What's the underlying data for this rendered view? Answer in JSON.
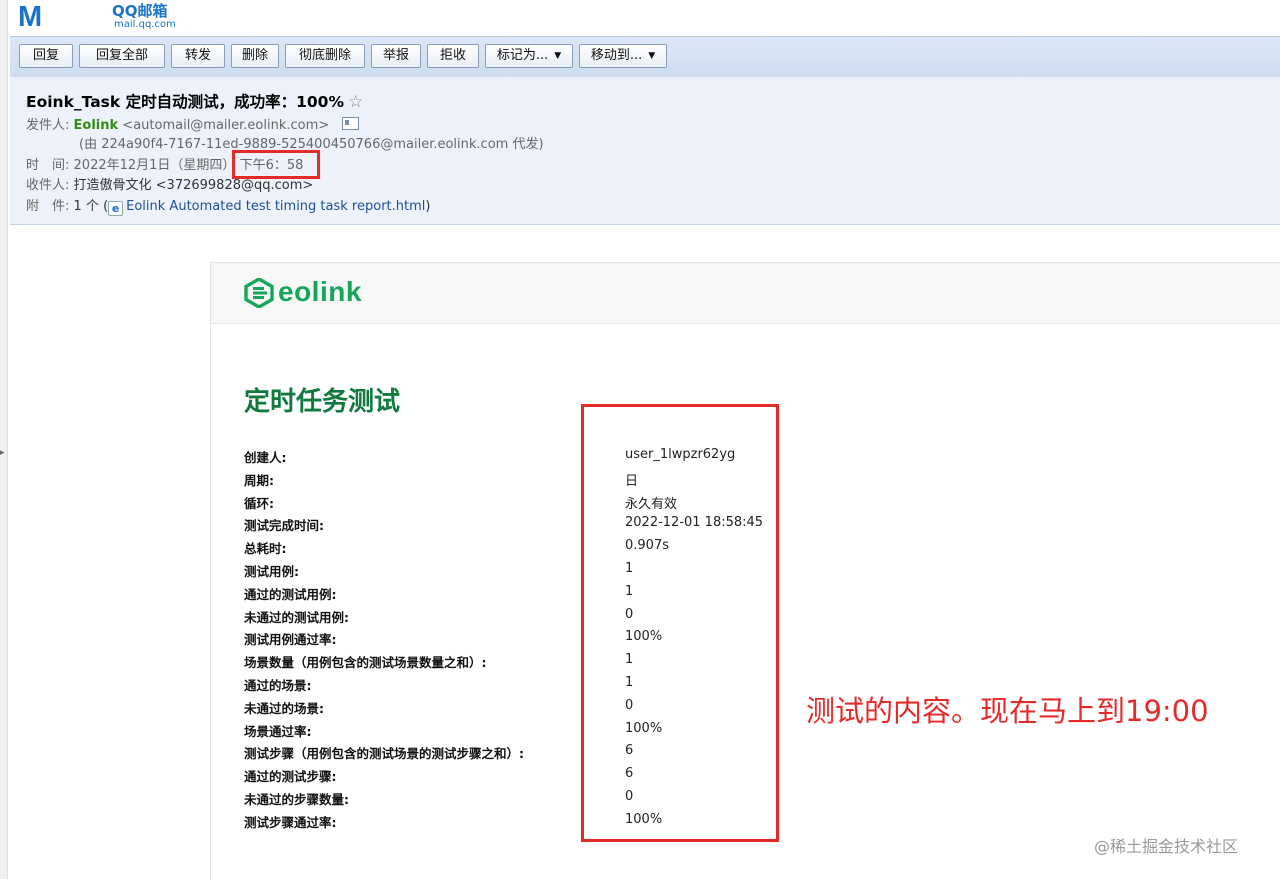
{
  "logo": {
    "brand": "Mail",
    "product": "QQ邮箱",
    "domain": "mail.qq.com"
  },
  "toolbar": {
    "reply": "回复",
    "reply_all": "回复全部",
    "forward": "转发",
    "delete": "删除",
    "delete_permanently": "彻底删除",
    "report": "举报",
    "reject": "拒收",
    "mark_as": "标记为...",
    "move_to": "移动到..."
  },
  "email": {
    "subject": "Eoink_Task 定时自动测试，成功率：100%",
    "sender_label": "发件人:",
    "sender_name": "Eolink",
    "sender_address": "<automail@mailer.eolink.com>",
    "sent_on_behalf": "(由 224a90f4-7167-11ed-9889-525400450766@mailer.eolink.com 代发)",
    "time_label": "时　间:",
    "date": "2022年12月1日（星期四）",
    "time": "下午6：58",
    "recipient_label": "收件人:",
    "recipient": "打造傲骨文化 <372699828@qq.com>",
    "attachment_label": "附　件:",
    "attachment_count": "1 个 (",
    "attachment_name": "Eolink Automated test timing task report.html",
    "attachment_close": ")"
  },
  "report": {
    "brand": "eolink",
    "title": "定时任务测试",
    "rows": [
      {
        "label": "创建人:",
        "value": "user_1lwpzr62yg"
      },
      {
        "label": "周期:",
        "value": "日"
      },
      {
        "label": "循环:",
        "value": "永久有效"
      },
      {
        "label": "测试完成时间:",
        "value": "2022-12-01 18:58:45"
      },
      {
        "label": "总耗时:",
        "value": "0.907s"
      },
      {
        "label": "测试用例:",
        "value": "1"
      },
      {
        "label": "通过的测试用例:",
        "value": "1"
      },
      {
        "label": "未通过的测试用例:",
        "value": "0"
      },
      {
        "label": "测试用例通过率:",
        "value": "100%"
      },
      {
        "label": "场景数量（用例包含的测试场景数量之和）:",
        "value": "1"
      },
      {
        "label": "通过的场景:",
        "value": "1"
      },
      {
        "label": "未通过的场景:",
        "value": "0"
      },
      {
        "label": "场景通过率:",
        "value": "100%"
      },
      {
        "label": "测试步骤（用例包含的测试场景的测试步骤之和）:",
        "value": "6"
      },
      {
        "label": "通过的测试步骤:",
        "value": "6"
      },
      {
        "label": "未通过的步骤数量:",
        "value": "0"
      },
      {
        "label": "测试步骤通过率:",
        "value": "100%"
      }
    ]
  },
  "annotation": "测试的内容。现在马上到19:00",
  "watermark": "@稀土掘金技术社区",
  "colors": {
    "accent": "#1a73c8",
    "brand_green": "#17a55a",
    "title_green": "#107a3e",
    "highlight_red": "#e52a2a"
  }
}
